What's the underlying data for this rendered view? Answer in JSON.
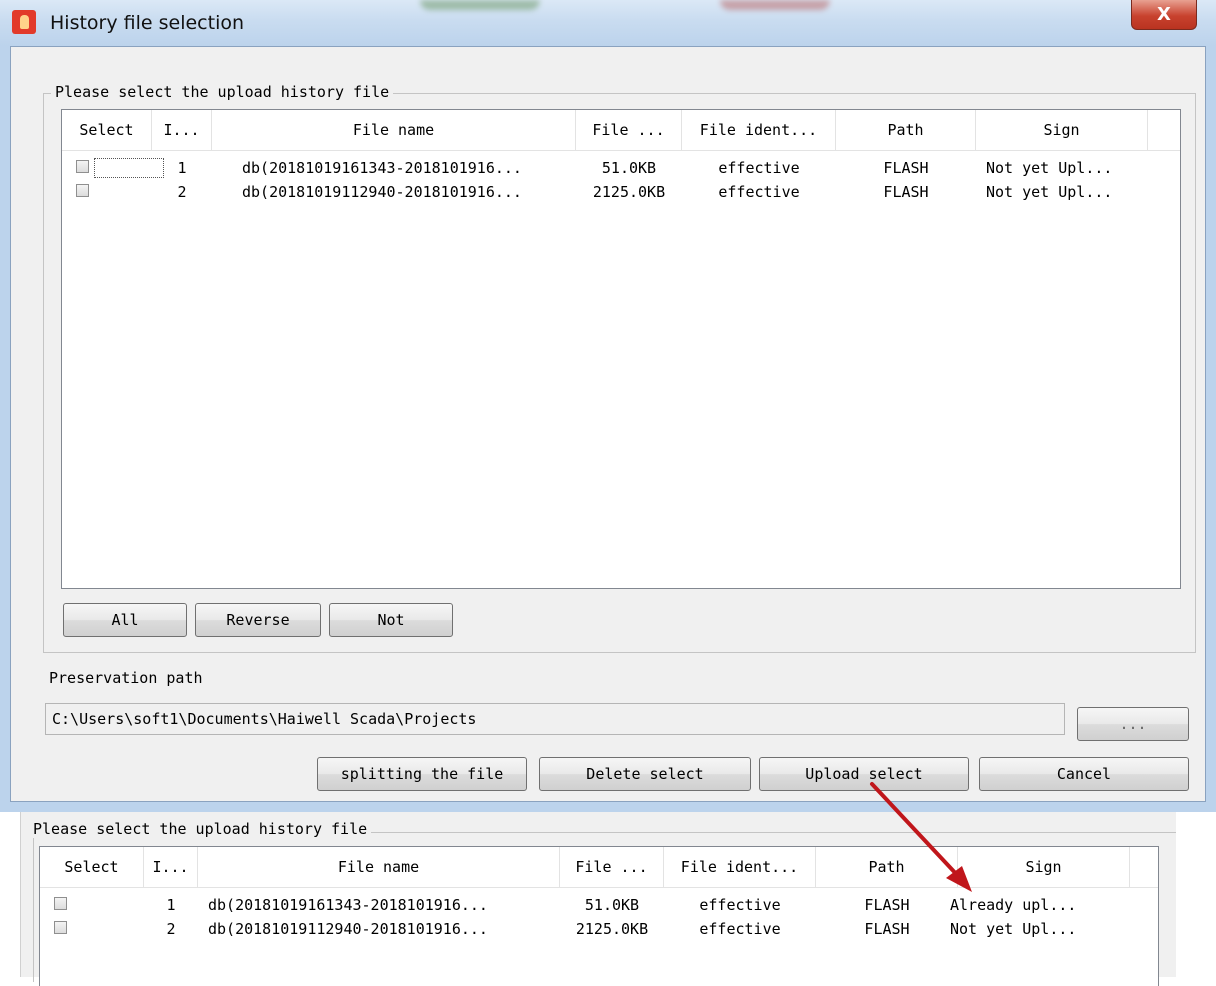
{
  "window": {
    "title": "History file selection",
    "close_label": "X"
  },
  "group": {
    "label": "Please select the upload history file"
  },
  "columns": [
    "Select",
    "I...",
    "File name",
    "File ...",
    "File ident...",
    "Path",
    "Sign"
  ],
  "rows": [
    {
      "index": "1",
      "file_name": "db(20181019161343-2018101916...",
      "file_size": "51.0KB",
      "file_ident": "effective",
      "path": "FLASH",
      "sign": "Not yet Upl...",
      "checked": false
    },
    {
      "index": "2",
      "file_name": "db(20181019112940-2018101916...",
      "file_size": "2125.0KB",
      "file_ident": "effective",
      "path": "FLASH",
      "sign": "Not yet Upl...",
      "checked": false
    }
  ],
  "selection_buttons": {
    "all": "All",
    "reverse": "Reverse",
    "not": "Not"
  },
  "preservation": {
    "label": "Preservation path",
    "value": "C:\\Users\\soft1\\Documents\\Haiwell Scada\\Projects",
    "browse_label": "..."
  },
  "actions": {
    "split": "splitting the file",
    "delete": "Delete select",
    "upload": "Upload select",
    "cancel": "Cancel"
  },
  "after_upload": {
    "group_label": "Please select the upload history file",
    "columns": [
      "Select",
      "I...",
      "File name",
      "File ...",
      "File ident...",
      "Path",
      "Sign"
    ],
    "rows": [
      {
        "index": "1",
        "file_name": "db(20181019161343-2018101916...",
        "file_size": "51.0KB",
        "file_ident": "effective",
        "path": "FLASH",
        "sign": "Already upl...",
        "checked": false
      },
      {
        "index": "2",
        "file_name": "db(20181019112940-2018101916...",
        "file_size": "2125.0KB",
        "file_ident": "effective",
        "path": "FLASH",
        "sign": "Not yet Upl...",
        "checked": false
      }
    ]
  },
  "colors": {
    "arrow": "#c0161b",
    "close_button": "#c8422e"
  }
}
